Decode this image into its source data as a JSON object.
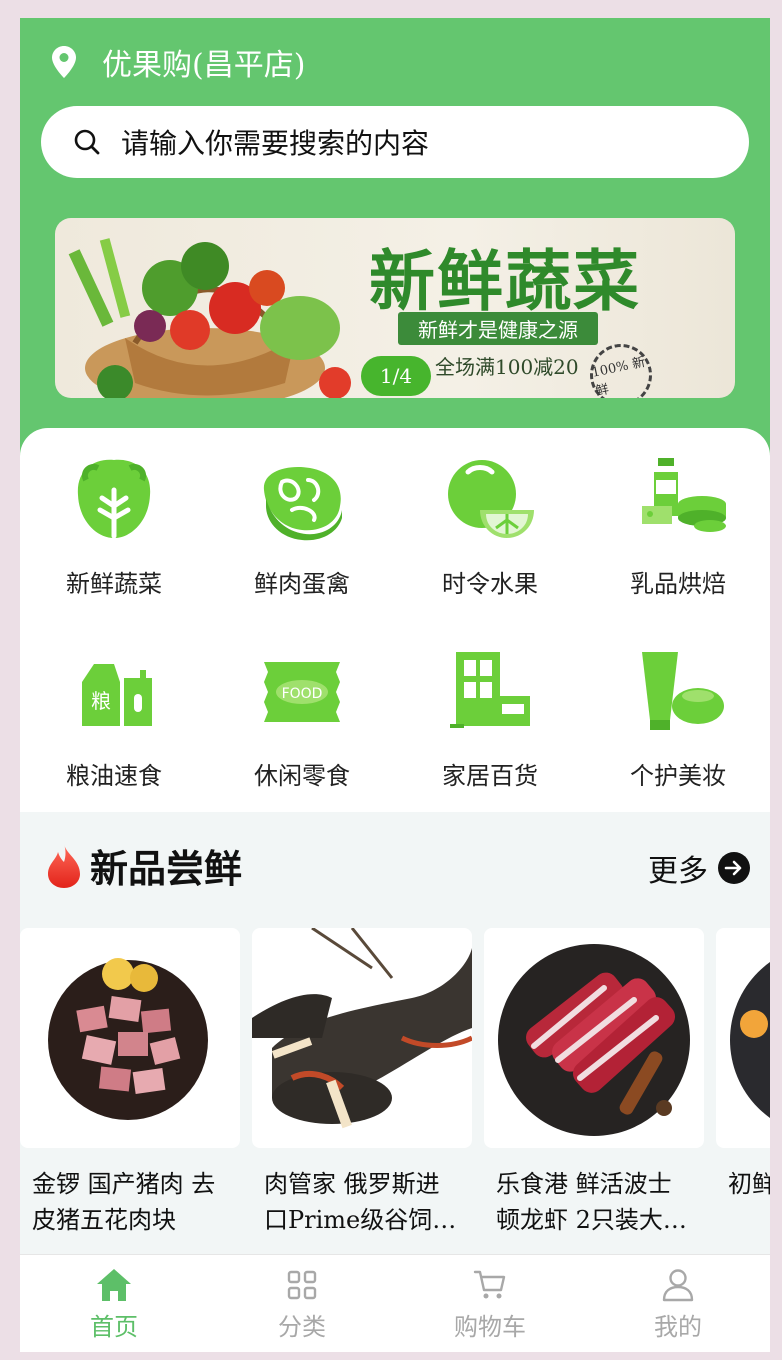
{
  "header": {
    "store_name": "优果购(昌平店)"
  },
  "search": {
    "placeholder": "请输入你需要搜索的内容"
  },
  "banner": {
    "title": "新鲜蔬菜",
    "subtitle": "新鲜才是健康之源",
    "promo": "全场满100减20",
    "seal": "100% 新鲜",
    "pager": "1/4"
  },
  "categories": [
    {
      "label": "新鲜蔬菜",
      "icon": "vegetable-icon"
    },
    {
      "label": "鲜肉蛋禽",
      "icon": "meat-icon"
    },
    {
      "label": "时令水果",
      "icon": "fruit-icon"
    },
    {
      "label": "乳品烘焙",
      "icon": "dairy-icon"
    },
    {
      "label": "粮油速食",
      "icon": "grain-oil-icon"
    },
    {
      "label": "休闲零食",
      "icon": "snack-icon"
    },
    {
      "label": "家居百货",
      "icon": "home-goods-icon"
    },
    {
      "label": "个护美妆",
      "icon": "personal-care-icon"
    }
  ],
  "section": {
    "title": "新品尝鲜",
    "more_label": "更多"
  },
  "products": [
    {
      "name": "金锣 国产猪肉 去皮猪五花肉块"
    },
    {
      "name": "肉管家 俄罗斯进口Prime级谷饲…"
    },
    {
      "name": "乐食港 鲜活波士顿龙虾 2只装大…"
    },
    {
      "name": "初鲜 冷冻…"
    }
  ],
  "tabbar": {
    "items": [
      {
        "label": "首页",
        "icon": "home-icon",
        "active": true
      },
      {
        "label": "分类",
        "icon": "category-grid-icon",
        "active": false
      },
      {
        "label": "购物车",
        "icon": "cart-icon",
        "active": false
      },
      {
        "label": "我的",
        "icon": "user-icon",
        "active": false
      }
    ]
  },
  "colors": {
    "brand_green": "#64c66f",
    "icon_green": "#6ccf3a",
    "tab_active": "#5dbf68",
    "tab_inactive": "#a8a8a8"
  }
}
